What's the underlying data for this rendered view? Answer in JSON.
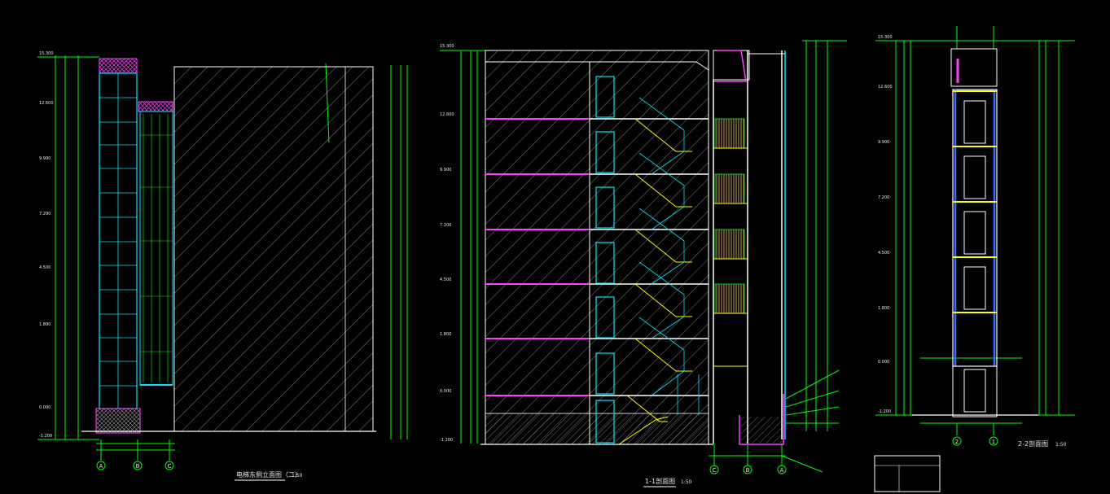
{
  "drawing": {
    "background": "#000000",
    "colors": {
      "dim": "#00ff00",
      "outline": "#ffffff",
      "glass": "#00e5ff",
      "floor": "#ff40ff",
      "stair": "#ffff00",
      "hatch": "#b8b8b8",
      "cladding": "#ff40ff",
      "wood": "#c8a050",
      "blue": "#3c6cff",
      "brick": "#c06060"
    }
  },
  "titles": {
    "left_title": "电梯东侧立面图（二）",
    "left_scale": "1:50",
    "mid_title": "1-1剖面图",
    "mid_scale": "1:50",
    "right_title": "2-2剖面图",
    "right_scale": "1:50"
  },
  "axes": {
    "left": [
      "A",
      "B",
      "C"
    ],
    "middle": [
      "C",
      "B",
      "A"
    ],
    "right": [
      "2",
      "1"
    ]
  },
  "elevations": {
    "left": [
      "15.300",
      "12.600",
      "9.900",
      "7.200",
      "4.500",
      "1.800",
      "0.000",
      "-1.200"
    ],
    "middle": [
      "15.300",
      "12.600",
      "9.900",
      "7.200",
      "4.500",
      "1.800",
      "0.000",
      "-1.200"
    ],
    "right": [
      "15.300",
      "12.600",
      "9.900",
      "7.200",
      "4.500",
      "1.800",
      "0.000",
      "-1.200"
    ]
  }
}
